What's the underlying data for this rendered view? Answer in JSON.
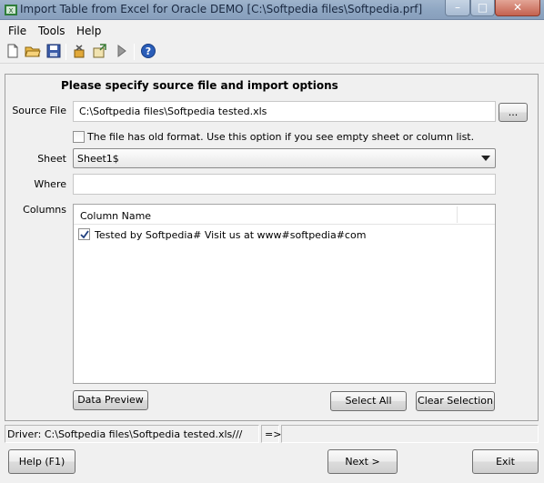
{
  "window": {
    "title": "Import Table from Excel for Oracle DEMO [C:\\Softpedia files\\Softpedia.prf]",
    "min_glyph": "–",
    "max_glyph": "□",
    "close_glyph": "✕"
  },
  "menu": {
    "items": [
      "File",
      "Tools",
      "Help"
    ]
  },
  "toolbar": {
    "icons": [
      "new-file-icon",
      "open-folder-icon",
      "save-disk-icon",
      "settings-icon",
      "export-icon",
      "run-arrow-icon",
      "help-icon"
    ]
  },
  "form": {
    "heading": "Please specify source file and import options",
    "source_label": "Source File",
    "source_value": "C:\\Softpedia files\\Softpedia tested.xls",
    "browse_label": "...",
    "old_format_label": "The file has old format. Use this option if you see empty sheet or column list.",
    "old_format_checked": false,
    "sheet_label": "Sheet",
    "sheet_value": "Sheet1$",
    "where_label": "Where",
    "where_value": "",
    "columns_label": "Columns",
    "columns_header": "Column Name",
    "columns": [
      {
        "name": "Tested by Softpedia# Visit us at www#softpedia#com",
        "checked": true
      }
    ],
    "data_preview_label": "Data Preview",
    "select_all_label": "Select All",
    "clear_selection_label": "Clear Selection"
  },
  "status": {
    "driver_text": "Driver: C:\\Softpedia files\\Softpedia tested.xls///",
    "arrow_text": "=>",
    "right_text": ""
  },
  "footer": {
    "help_label": "Help (F1)",
    "next_label": "Next >",
    "exit_label": "Exit"
  },
  "colors": {
    "window_bg": "#f0f0f0",
    "titlebar": "#8ea6c2",
    "close": "#c4614f"
  }
}
